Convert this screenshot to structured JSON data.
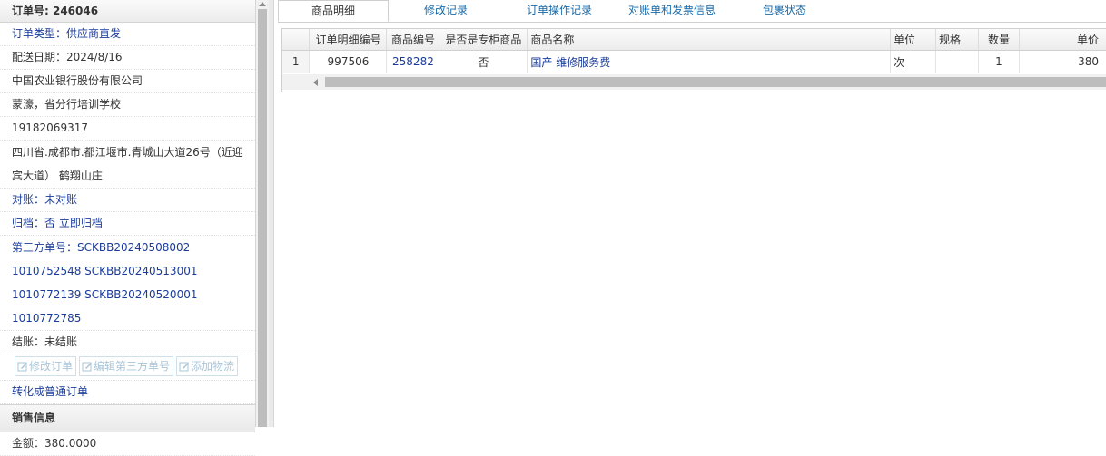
{
  "order": {
    "title": "订单号: 246046",
    "type": "订单类型：供应商直发",
    "delivery_date": "配送日期：2024/8/16",
    "company": "中国农业银行股份有限公司",
    "contact": "蒙濠，省分行培训学校",
    "phone": "19182069317",
    "address": "四川省.成都市.都江堰市.青城山大道26号（近迎宾大道） 鹤翔山庄",
    "reconcile": "对账：未对账",
    "archive": "归档：否 立即归档",
    "third_party_numbers": "第三方单号：SCKBB20240508002 1010752548 SCKBB20240513001 1010772139 SCKBB20240520001 1010772785",
    "settlement": "结账：未结账",
    "buttons": [
      "修改订单",
      "编辑第三方单号",
      "添加物流"
    ],
    "convert_link": "转化成普通订单",
    "sales_section": "销售信息",
    "amount": "金额：380.0000"
  },
  "tabs": [
    "商品明细",
    "修改记录",
    "订单操作记录",
    "对账单和发票信息",
    "包裹状态"
  ],
  "active_tab": 0,
  "grid": {
    "columns": [
      "订单明细编号",
      "商品编号",
      "是否是专柜商品",
      "商品名称",
      "单位",
      "规格",
      "数量",
      "单价"
    ],
    "rows": [
      {
        "rownum": "1",
        "detail_id": "997506",
        "product_id": "258282",
        "is_counter": "否",
        "name": "国产 维修服务费",
        "unit": "次",
        "spec": "",
        "qty": "1",
        "price": "380"
      }
    ]
  },
  "icons": {
    "edit": "edit-icon"
  }
}
